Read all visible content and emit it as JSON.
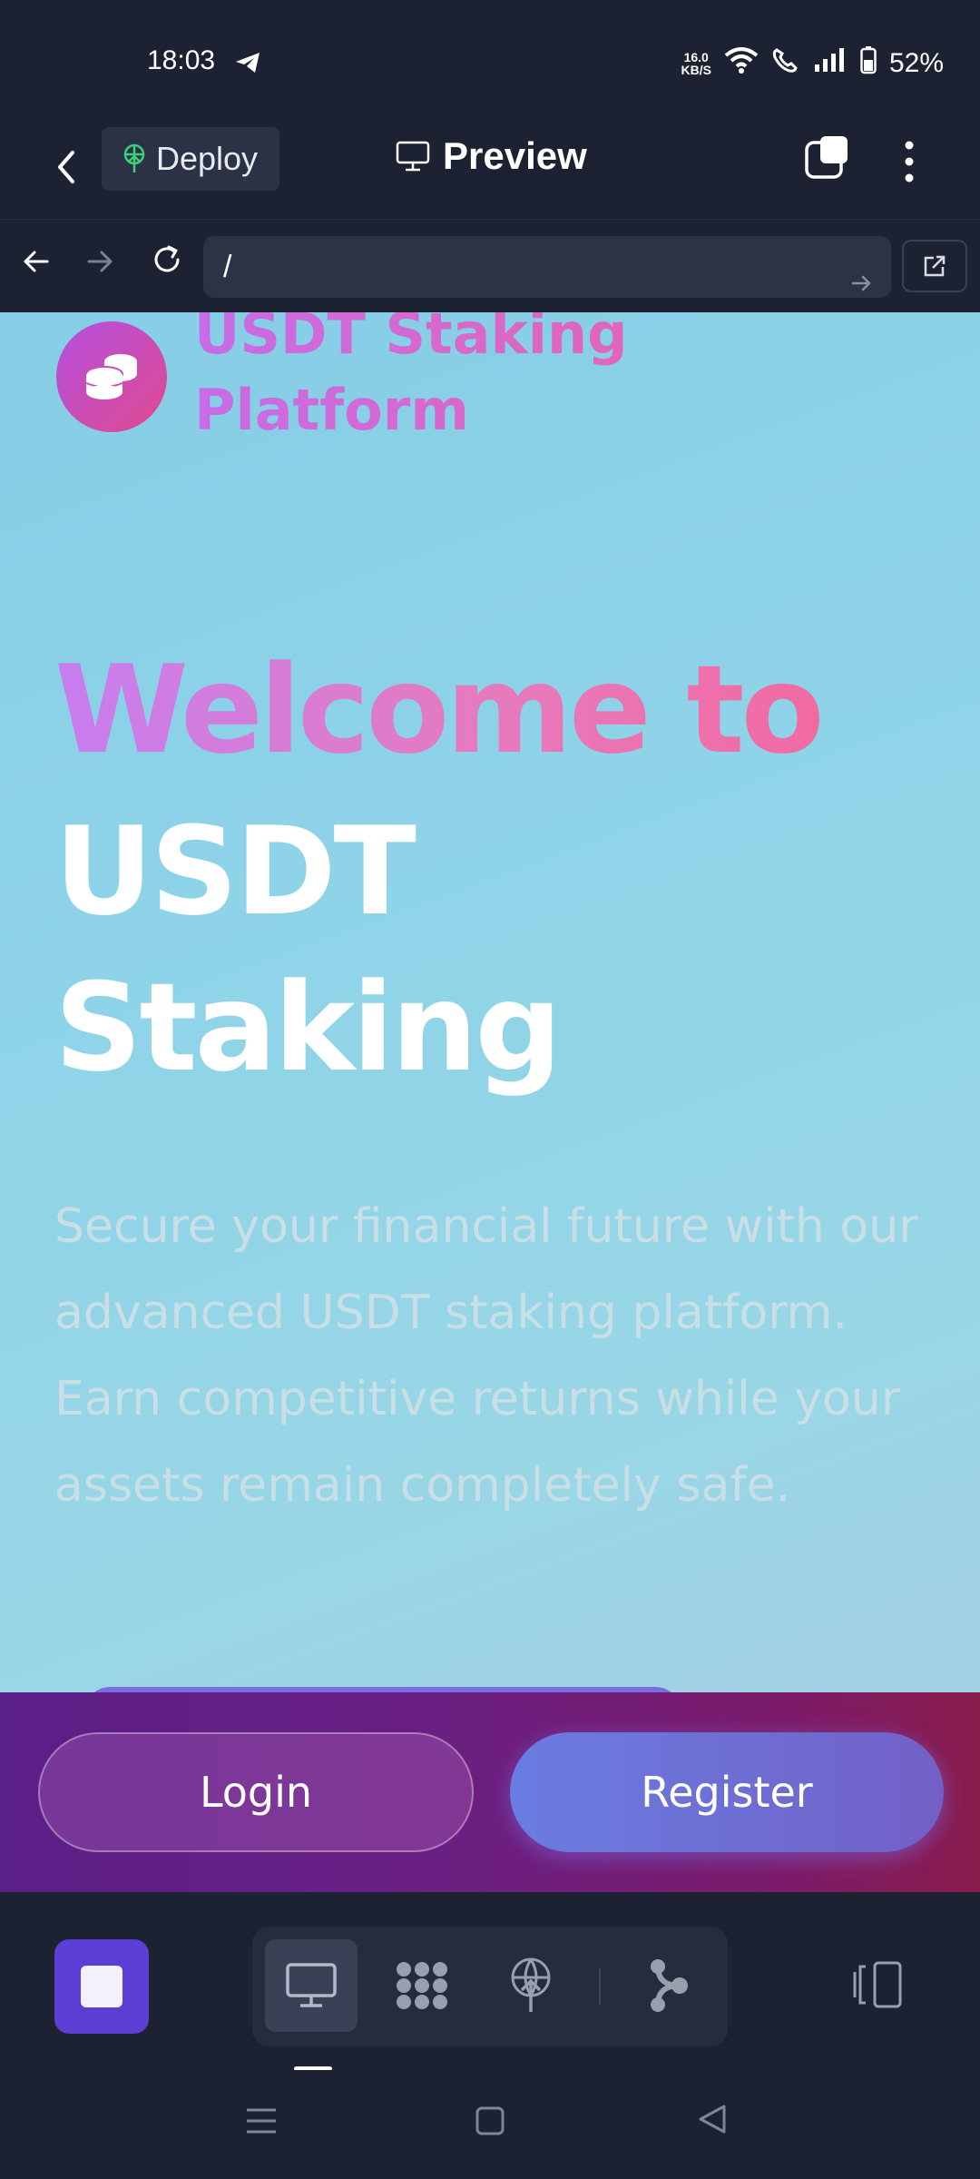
{
  "status_bar": {
    "time": "18:03",
    "net_speed_value": "16.0",
    "net_speed_unit": "KB/S",
    "battery": "52%"
  },
  "header": {
    "deploy_label": "Deploy",
    "preview_label": "Preview"
  },
  "url_bar": {
    "url": "/"
  },
  "site": {
    "name": "USDT Staking Platform",
    "hero_line1": "Welcome to",
    "hero_line2": "USDT Staking",
    "description": "Secure your financial future with our advanced USDT staking platform. Earn competitive returns while your assets remain completely safe."
  },
  "auth": {
    "login_label": "Login",
    "register_label": "Register"
  },
  "colors": {
    "accent_purple": "#5b3fd4",
    "deploy_green": "#3ecf7a",
    "hero_gradient_start": "#c77df0",
    "hero_gradient_end": "#f26aa2"
  },
  "icons": {
    "toolbar": [
      "monitor-icon",
      "cluster-icon",
      "deploy-globe-icon",
      "branch-icon",
      "device-toggle-icon"
    ]
  }
}
